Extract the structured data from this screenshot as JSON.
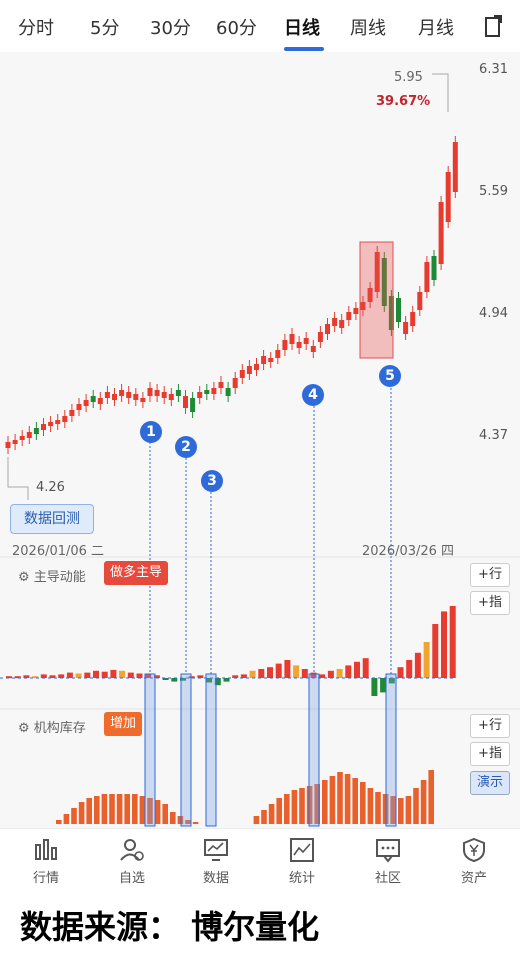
{
  "tabs": [
    {
      "label": "分时"
    },
    {
      "label": "5分"
    },
    {
      "label": "30分"
    },
    {
      "label": "60分"
    },
    {
      "label": "日线",
      "active": true
    },
    {
      "label": "周线"
    },
    {
      "label": "月线"
    }
  ],
  "price_axis": [
    "6.31",
    "5.59",
    "4.94",
    "4.37"
  ],
  "high_label": "5.95",
  "high_pct": "39.67%",
  "low_label": "4.26",
  "backtest_label": "数据回测",
  "date_start": "2026/01/06 二",
  "date_end": "2026/03/26 四",
  "panel1": {
    "title": "主导动能",
    "tag": "做多主导"
  },
  "panel2": {
    "title": "机构库存",
    "tag": "增加"
  },
  "side": {
    "row": "+行",
    "idx": "+指",
    "row2": "+行",
    "idx2": "+指",
    "demo": "演示"
  },
  "markers": [
    "1",
    "2",
    "3",
    "4",
    "5"
  ],
  "nav": [
    "行情",
    "自选",
    "数据",
    "统计",
    "社区",
    "资产"
  ],
  "footer": "数据来源： 博尔量化",
  "colors": {
    "up": "#e63b2e",
    "down": "#1f8a35",
    "accent": "#2f6bd8",
    "orange": "#f0a531"
  }
}
